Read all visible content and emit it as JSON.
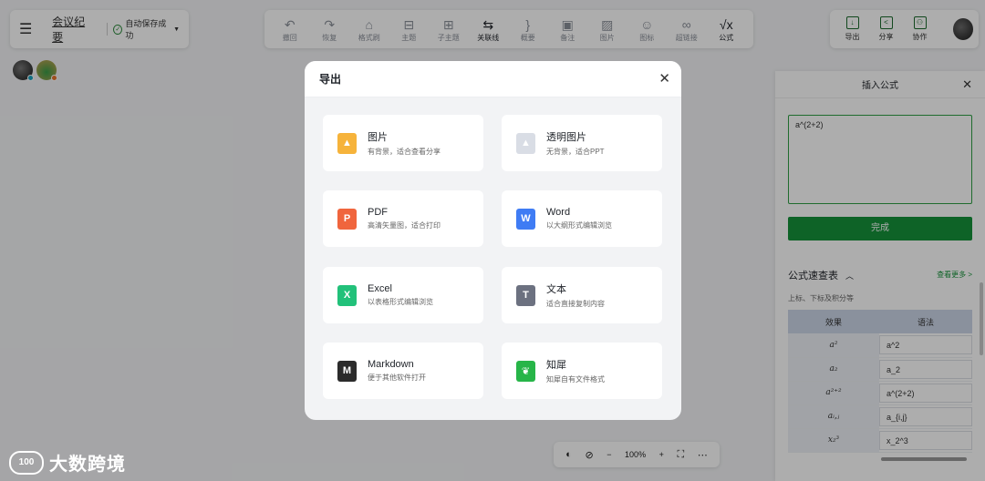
{
  "header": {
    "doc_title": "会议纪要",
    "save_status": "自动保存成功"
  },
  "toolbar": [
    {
      "label": "撤回",
      "icon": "undo-icon",
      "glyph": "↶"
    },
    {
      "label": "恢复",
      "icon": "redo-icon",
      "glyph": "↷"
    },
    {
      "label": "格式刷",
      "icon": "format-painter-icon",
      "glyph": "⌂"
    },
    {
      "label": "主题",
      "icon": "topic-icon",
      "glyph": "⊟"
    },
    {
      "label": "子主题",
      "icon": "subtopic-icon",
      "glyph": "⊞"
    },
    {
      "label": "关联线",
      "icon": "relation-line-icon",
      "glyph": "⇆"
    },
    {
      "label": "概要",
      "icon": "summary-icon",
      "glyph": "}"
    },
    {
      "label": "备注",
      "icon": "note-icon",
      "glyph": "▣"
    },
    {
      "label": "图片",
      "icon": "image-icon",
      "glyph": "▨"
    },
    {
      "label": "图标",
      "icon": "emoji-icon",
      "glyph": "☺"
    },
    {
      "label": "超链接",
      "icon": "link-icon",
      "glyph": "∞"
    },
    {
      "label": "公式",
      "icon": "formula-icon",
      "glyph": "√x"
    }
  ],
  "right_toolbar": [
    {
      "label": "导出",
      "icon": "export-icon",
      "glyph": "↓"
    },
    {
      "label": "分享",
      "icon": "share-icon",
      "glyph": "<"
    },
    {
      "label": "协作",
      "icon": "collaborate-icon",
      "glyph": "⚇"
    }
  ],
  "formula_panel": {
    "title": "插入公式",
    "input_value": "a^(2+2)",
    "done_label": "完成",
    "quick_title": "公式速查表",
    "more_link": "查看更多 >",
    "sub_title": "上标、下标及积分等",
    "col_effect": "效果",
    "col_syntax": "语法",
    "rows": [
      {
        "effect": "a²",
        "syntax": "a^2"
      },
      {
        "effect": "a₂",
        "syntax": "a_2"
      },
      {
        "effect": "a²⁺²",
        "syntax": "a^(2+2)"
      },
      {
        "effect": "aᵢ,ⱼ",
        "syntax": "a_{i,j}"
      },
      {
        "effect": "x₂³",
        "syntax": "x_2^3"
      }
    ]
  },
  "zoom": {
    "level": "100%",
    "minus": "−",
    "plus": "+"
  },
  "modal": {
    "title": "导出",
    "options": [
      {
        "title": "图片",
        "desc": "有背景，适合查看分享",
        "icon": "image-file-icon",
        "glyph": "▲",
        "color": "#f6b33b"
      },
      {
        "title": "透明图片",
        "desc": "无背景，适合PPT",
        "icon": "transparent-image-file-icon",
        "glyph": "▲",
        "color": "#d9dde5"
      },
      {
        "title": "PDF",
        "desc": "高清矢量图，适合打印",
        "icon": "pdf-file-icon",
        "glyph": "P",
        "color": "#f0653d"
      },
      {
        "title": "Word",
        "desc": "以大纲形式编辑浏览",
        "icon": "word-file-icon",
        "glyph": "W",
        "color": "#3f7cf4"
      },
      {
        "title": "Excel",
        "desc": "以表格形式编辑浏览",
        "icon": "excel-file-icon",
        "glyph": "X",
        "color": "#22c17a"
      },
      {
        "title": "文本",
        "desc": "适合直接复制内容",
        "icon": "text-file-icon",
        "glyph": "T",
        "color": "#6c7180"
      },
      {
        "title": "Markdown",
        "desc": "便于其他软件打开",
        "icon": "markdown-file-icon",
        "glyph": "M",
        "color": "#2b2b2b"
      },
      {
        "title": "知犀",
        "desc": "知犀自有文件格式",
        "icon": "zhixi-file-icon",
        "glyph": "❦",
        "color": "#27b548"
      }
    ]
  },
  "watermark": {
    "logo_text": "100",
    "text": "大数跨境"
  }
}
